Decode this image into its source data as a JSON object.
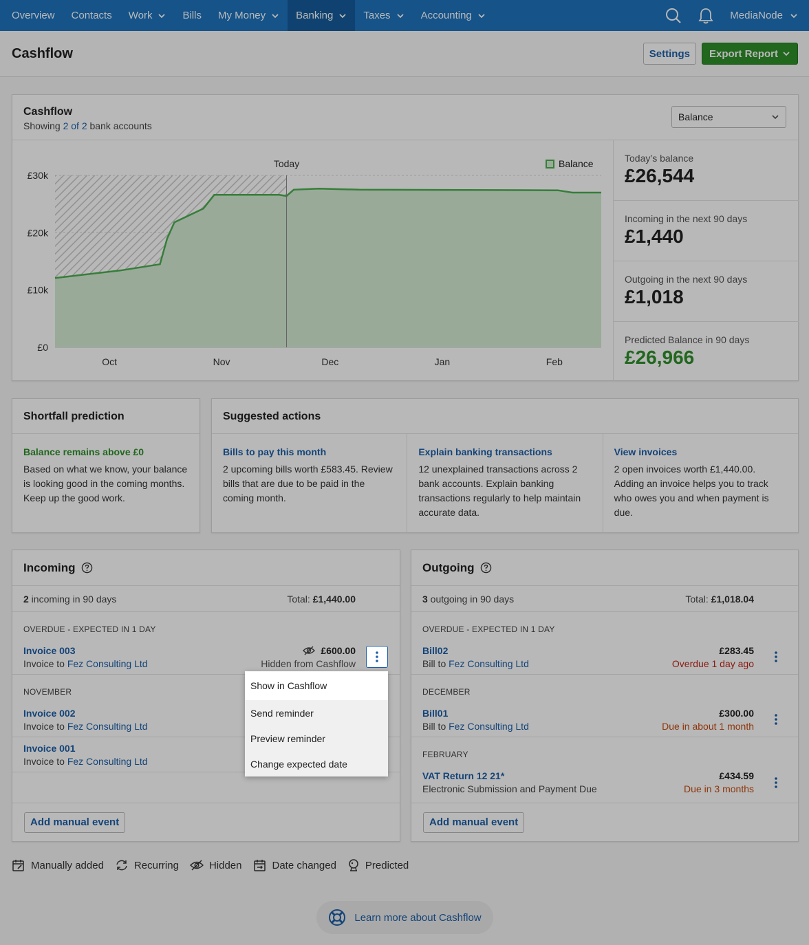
{
  "nav": {
    "items": [
      {
        "label": "Overview",
        "caret": false,
        "active": false
      },
      {
        "label": "Contacts",
        "caret": false,
        "active": false
      },
      {
        "label": "Work",
        "caret": true,
        "active": false
      },
      {
        "label": "Bills",
        "caret": false,
        "active": false
      },
      {
        "label": "My Money",
        "caret": true,
        "active": false
      },
      {
        "label": "Banking",
        "caret": true,
        "active": true
      },
      {
        "label": "Taxes",
        "caret": true,
        "active": false
      },
      {
        "label": "Accounting",
        "caret": true,
        "active": false
      }
    ],
    "org_name": "MediaNode",
    "icons": [
      "search-icon",
      "bell-icon",
      "chevron-down-icon"
    ]
  },
  "header": {
    "title": "Cashflow",
    "settings_label": "Settings",
    "export_label": "Export Report"
  },
  "cashflow": {
    "title": "Cashflow",
    "subtitle_prefix": "Showing ",
    "subtitle_link": "2 of 2",
    "subtitle_suffix": " bank accounts",
    "view_select": "Balance",
    "stats": [
      {
        "label": "Today’s balance",
        "value": "£26,544"
      },
      {
        "label": "Incoming in the next 90 days",
        "value": "£1,440"
      },
      {
        "label": "Outgoing in the next 90 days",
        "value": "£1,018"
      },
      {
        "label": "Predicted Balance in 90 days",
        "value": "£26,966"
      }
    ]
  },
  "chart_data": {
    "type": "area",
    "title": "",
    "today_label": "Today",
    "legend": [
      "Balance"
    ],
    "legend_position": "top-right",
    "x_ticks": [
      "Oct",
      "Nov",
      "Dec",
      "Jan",
      "Feb"
    ],
    "y_ticks": [
      "£0",
      "£10k",
      "£20k",
      "£30k"
    ],
    "ylim": [
      0,
      30000
    ],
    "grid": true,
    "series": [
      {
        "name": "Balance",
        "color": "#4caf50",
        "points": [
          {
            "date": "2021-09-19",
            "value": 12100
          },
          {
            "date": "2021-10-07",
            "value": 13400
          },
          {
            "date": "2021-10-18",
            "value": 14500
          },
          {
            "date": "2021-10-20",
            "value": 19000
          },
          {
            "date": "2021-10-22",
            "value": 21800
          },
          {
            "date": "2021-10-30",
            "value": 24200
          },
          {
            "date": "2021-11-02",
            "value": 26600
          },
          {
            "date": "2021-11-20",
            "value": 26600
          },
          {
            "date": "2021-11-22",
            "value": 26400
          },
          {
            "date": "2021-11-24",
            "value": 27500
          },
          {
            "date": "2021-12-01",
            "value": 27700
          },
          {
            "date": "2021-12-12",
            "value": 27500
          },
          {
            "date": "2022-02-05",
            "value": 27400
          },
          {
            "date": "2022-02-09",
            "value": 27000
          },
          {
            "date": "2022-02-17",
            "value": 27000
          }
        ]
      }
    ],
    "today_date": "2021-11-22",
    "history_hatched": true
  },
  "shortfall": {
    "title": "Shortfall prediction",
    "status": "Balance remains above £0",
    "text": "Based on what we know, your balance is looking good in the coming months. Keep up the good work."
  },
  "suggested": {
    "title": "Suggested actions",
    "items": [
      {
        "title": "Bills to pay this month",
        "text": "2 upcoming bills worth £583.45. Review bills that are due to be paid in the coming month."
      },
      {
        "title": "Explain banking transactions",
        "text": "12 unexplained transactions across 2 bank accounts. Explain banking transactions regularly to help maintain accurate data."
      },
      {
        "title": "View invoices",
        "text": "2 open invoices worth £1,440.00. Adding an invoice helps you to track who owes you and when payment is due."
      }
    ]
  },
  "incoming": {
    "title": "Incoming",
    "count": "2",
    "count_suffix": " incoming in 90 days",
    "total_label": "Total: ",
    "total": "£1,440.00",
    "add_label": "Add manual event",
    "groups": [
      {
        "label": "OVERDUE - EXPECTED IN 1 DAY",
        "rows": [
          {
            "title": "Invoice 003",
            "sub_prefix": "Invoice to ",
            "contact": "Fez Consulting Ltd",
            "amount": "£600.00",
            "status": "Hidden from Cashflow",
            "hidden": true
          }
        ]
      },
      {
        "label": "NOVEMBER",
        "rows": [
          {
            "title": "Invoice 002",
            "sub_prefix": "Invoice to ",
            "contact": "Fez Consulting Ltd"
          },
          {
            "title": "Invoice 001",
            "sub_prefix": "Invoice to ",
            "contact": "Fez Consulting Ltd"
          }
        ]
      }
    ]
  },
  "outgoing": {
    "title": "Outgoing",
    "count": "3",
    "count_suffix": " outgoing in 90 days",
    "total_label": "Total: ",
    "total": "£1,018.04",
    "add_label": "Add manual event",
    "groups": [
      {
        "label": "OVERDUE - EXPECTED IN 1 DAY",
        "rows": [
          {
            "title": "Bill02",
            "sub_prefix": "Bill to ",
            "contact": "Fez Consulting Ltd",
            "amount": "£283.45",
            "status": "Overdue 1 day ago",
            "status_color": "#c0261a"
          }
        ]
      },
      {
        "label": "DECEMBER",
        "rows": [
          {
            "title": "Bill01",
            "sub_prefix": "Bill to ",
            "contact": "Fez Consulting Ltd",
            "amount": "£300.00",
            "status": "Due in about 1 month",
            "status_color": "#c54b12"
          }
        ]
      },
      {
        "label": "FEBRUARY",
        "rows": [
          {
            "title": "VAT Return 12 21*",
            "sub_prefix": "Electronic Submission and Payment Due",
            "contact": "",
            "amount": "£434.59",
            "status": "Due in 3 months",
            "status_color": "#c54b12"
          }
        ]
      }
    ]
  },
  "menu": {
    "items": [
      "Show in Cashflow",
      "Send reminder",
      "Preview reminder",
      "Change expected date"
    ]
  },
  "legend": {
    "items": [
      {
        "icon": "calendar-edit-icon",
        "label": "Manually added"
      },
      {
        "icon": "recurring-icon",
        "label": "Recurring"
      },
      {
        "icon": "eye-off-icon",
        "label": "Hidden"
      },
      {
        "icon": "calendar-change-icon",
        "label": "Date changed"
      },
      {
        "icon": "predicted-icon",
        "label": "Predicted"
      }
    ]
  },
  "learn_more": {
    "label": "Learn more about Cashflow",
    "icon": "lifebuoy-icon"
  }
}
